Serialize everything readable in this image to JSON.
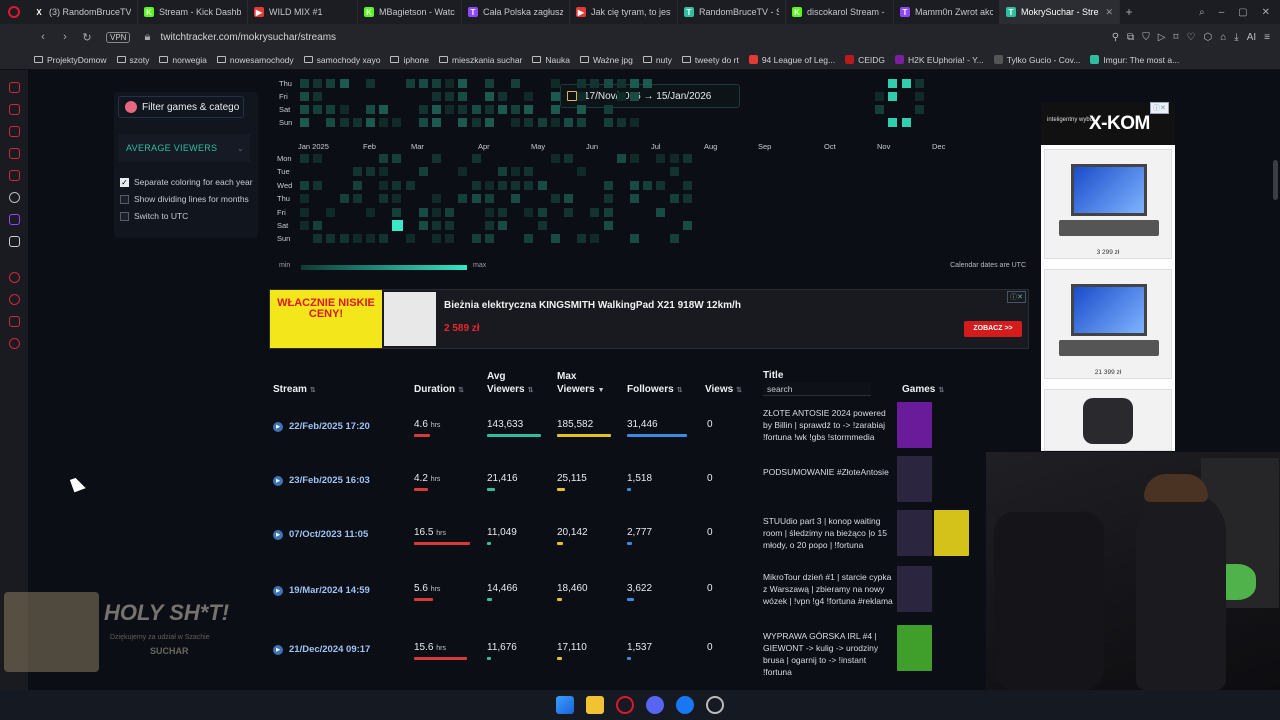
{
  "browser": {
    "tabs": [
      {
        "label": "(3) RandomBruceTV (",
        "color": "#1d1d1d",
        "glyph": "X"
      },
      {
        "label": "Stream - Kick Dashbo",
        "color": "#53fc18",
        "glyph": "K"
      },
      {
        "label": "WILD MIX #1 ",
        "color": "#e53935",
        "glyph": "▶"
      },
      {
        "label": "MBagietson - Watch",
        "color": "#53fc18",
        "glyph": "K"
      },
      {
        "label": "Cała Polska zagłusza",
        "color": "#9146ff",
        "glyph": "T"
      },
      {
        "label": "Jak cię tyram, to jeste",
        "color": "#e53935",
        "glyph": "▶"
      },
      {
        "label": "RandomBruceTV - St",
        "color": "#2fbf9f",
        "glyph": "T"
      },
      {
        "label": "discokarol Stream - V",
        "color": "#53fc18",
        "glyph": "K"
      },
      {
        "label": "Mamm0n Zwrot akcji",
        "color": "#9146ff",
        "glyph": "T"
      },
      {
        "label": "MokrySuchar - Streams Li",
        "color": "#2fbf9f",
        "glyph": "T",
        "active": true
      }
    ],
    "url": "twitchtracker.com/mokrysuchar/streams",
    "vpn": "VPN",
    "bookmarks": [
      "ProjektyDomow",
      "szoty",
      "norwegia",
      "nowesamochody",
      "samochody xayo",
      "iphone",
      "mieszkania suchar",
      "Nauka",
      "Ważne jpg",
      "nuty",
      "tweety do rt",
      "94 League of Leg...",
      "CEIDG",
      "H2K EUphoria! - Y...",
      "Tylko Gucio - Cov...",
      "Imgur: The most a..."
    ]
  },
  "filters": {
    "button_label": "Filter games & catego",
    "metric_label": "AVERAGE VIEWERS",
    "checkboxes": [
      {
        "label": "Separate coloring for each year",
        "checked": true
      },
      {
        "label": "Show dividing lines for months",
        "checked": false
      },
      {
        "label": "Switch to UTC",
        "checked": false
      }
    ]
  },
  "heatmap": {
    "date_range": "17/Nov/2016 → 15/Jan/2026",
    "days_top": [
      "Thu",
      "Fri",
      "Sat",
      "Sun"
    ],
    "days": [
      "Mon",
      "Tue",
      "Wed",
      "Thu",
      "Fri",
      "Sat",
      "Sun"
    ],
    "months": [
      "Jan 2025",
      "Feb",
      "Mar",
      "Apr",
      "May",
      "Jun",
      "Jul",
      "Aug",
      "Sep",
      "Oct",
      "Nov",
      "Dec"
    ],
    "legend_min": "min",
    "legend_max": "max",
    "note": "Calendar dates are UTC"
  },
  "ad": {
    "promo": "WŁACZNIE NISKIE CENY!",
    "title": "Bieżnia elektryczna KINGSMITH WalkingPad X21 918W 12km/h",
    "price": "2 589 zł",
    "cta": "ZOBACZ >>",
    "brand_small": "expert"
  },
  "table": {
    "headers": {
      "stream": "Stream",
      "duration": "Duration",
      "avg1": "Avg",
      "avg2": "Viewers",
      "max1": "Max",
      "max2": "Viewers",
      "followers": "Followers",
      "views": "Views",
      "title": "Title",
      "games": "Games"
    },
    "search_placeholder": "search",
    "rows": [
      {
        "date": "22/Feb/2025 17:20",
        "duration": "4.6",
        "unit": "hrs",
        "avg": "143,633",
        "max": "185,582",
        "followers": "31,446",
        "views": "0",
        "title": "ZŁOTE ANTOSIE 2024 powered by Billin | sprawdź to -> !zarabiaj !fortuna !wk !gbs !stormmedia",
        "games": [
          "#6a1b9a"
        ]
      },
      {
        "date": "23/Feb/2025 16:03",
        "duration": "4.2",
        "unit": "hrs",
        "avg": "21,416",
        "max": "25,115",
        "followers": "1,518",
        "views": "0",
        "title": "PODSUMOWANIE #ZłoteAntosie",
        "games": [
          "#2b2540"
        ]
      },
      {
        "date": "07/Oct/2023 11:05",
        "duration": "16.5",
        "unit": "hrs",
        "avg": "11,049",
        "max": "20,142",
        "followers": "2,777",
        "views": "0",
        "title": "STUUdio part 3 | konop waiting room | śledzimy na bieżąco |o 15 młody, o 20 popo | !fortuna",
        "games": [
          "#2b2540",
          "#d4c21a"
        ]
      },
      {
        "date": "19/Mar/2024 14:59",
        "duration": "5.6",
        "unit": "hrs",
        "avg": "14,466",
        "max": "18,460",
        "followers": "3,622",
        "views": "0",
        "title": "MikroTour dzień #1 | starcie cypka z Warszawą | zbieramy na nowy wózek | !vpn !g4 !fortuna #reklama",
        "games": [
          "#2b2540"
        ]
      },
      {
        "date": "21/Dec/2024 09:17",
        "duration": "15.6",
        "unit": "hrs",
        "avg": "11,676",
        "max": "17,110",
        "followers": "1,537",
        "views": "0",
        "title": "WYPRAWA GÓRSKA IRL #4 | GIEWONT -> kulig -> urodziny brusa | ogarnij to -> !instant !fortuna",
        "games": [
          "#3f9f2a"
        ]
      }
    ],
    "bar_levels": {
      "avg": [
        1.0,
        0.15,
        0.08,
        0.1,
        0.08
      ],
      "max": [
        1.0,
        0.14,
        0.11,
        0.1,
        0.09
      ],
      "followers": [
        1.0,
        0.05,
        0.09,
        0.12,
        0.05
      ],
      "duration": [
        0.28,
        0.25,
        1.0,
        0.34,
        0.95
      ]
    },
    "bar_colors": {
      "avg": "#2fbf9f",
      "max": "#e5c21f",
      "followers": "#3a8ae0",
      "duration": "#d83a3a"
    }
  },
  "sidead": {
    "small": "inteligentny wybór",
    "brand": "X-KOM",
    "prices": [
      "3 299 zł",
      "21 399 zł"
    ]
  },
  "overlay": {
    "title": "HOLY SH*T!",
    "sub": "Dziękujemy za udział w Szachie",
    "sub2": "SUCHAR"
  }
}
